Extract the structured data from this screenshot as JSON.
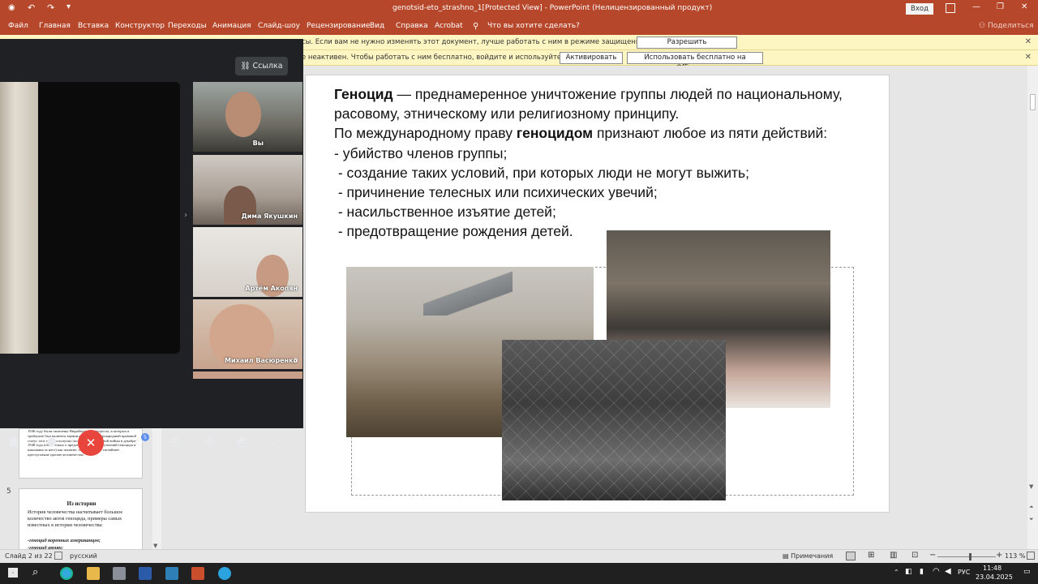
{
  "titlebar": {
    "quick_access_autosave": "◉",
    "quick_access_undo": "↶",
    "quick_access_redo": "↷",
    "quick_access_more": "▾",
    "doc_title": "genotsid-eto_strashno_1[Protected View]  -  PowerPoint (Нелицензированный продукт)",
    "signin_label": "Вход",
    "min": "—",
    "restore": "❐",
    "close": "✕"
  },
  "ribbon_tabs": [
    "Файл",
    "Главная",
    "Вставка",
    "Конструктор",
    "Переходы",
    "Анимация",
    "Слайд-шоу",
    "Рецензирование",
    "Вид",
    "Справка",
    "Acrobat"
  ],
  "tell_me": "Что вы хотите сделать?",
  "share_label": "Поделиться",
  "message_bar_1": {
    "text": "сы. Если вам не нужно изменять этот документ, лучше работать с ним в режиме защищенного просмотра.",
    "button": "Разрешить редактирование"
  },
  "message_bar_2": {
    "text": "е неактивен. Чтобы работать с ним бесплатно, войдите и используйте веб-версию.",
    "button_activate": "Активировать",
    "button_web": "Использовать бесплатно на Office.com"
  },
  "slide": {
    "term": "Геноцид",
    "def_rest": " — преднамеренное уничтожение группы людей по национальному, расовому, этническому или религиозному принципу.",
    "intro_pre": "По международному праву ",
    "intro_term": "геноцидом",
    "intro_post": " признают любое из пяти действий:",
    "items": [
      "- убийство членов группы;",
      " - создание таких условий, при которых люди не могут выжить;",
      " - причинение телесных или психических увечий;",
      " - насильственное изъятие детей;",
      " - предотвращение рождения детей."
    ]
  },
  "thumbnails": {
    "slide3_text": "1946 году были окончены Нюрнбергские процессы, в которых в трибунале был включен термин геноцид. Международный правовой статус этот термин получил после Второй мировой войны в декабре 1948 года (обязательно о предотвращении преступлений геноцида и наказания за него) как понятие, определяющее тягчайшее преступление против человечества.",
    "slide5_number": "5",
    "slide5_title": "Из истории",
    "slide5_body": "История человечества насчитывает большое количество актов геноцида, примеры самых известных в истории человечества:",
    "slide5_item1": "-геноцид коренных американцев;",
    "slide5_item2": "-геноцид армян;"
  },
  "statusbar": {
    "slide_counter": "Слайд 2 из 22",
    "language": "русский",
    "notes": "Примечания",
    "zoom": "113 %",
    "zoom_level": 0.56
  },
  "taskbar": {
    "time": "11:48",
    "date": "23.04.2025",
    "lang": "РУС"
  },
  "call": {
    "link_button": "Ссылка",
    "participants": [
      "Вы",
      "Дима Якушкин",
      "Артём Акопян",
      "Михаил Васюренко"
    ],
    "participants_badge": "5"
  },
  "colors": {
    "ppt_accent": "#b7472a",
    "message_bar": "#fdf6c3",
    "call_bg": "#202124",
    "end_call": "#e8453c"
  }
}
